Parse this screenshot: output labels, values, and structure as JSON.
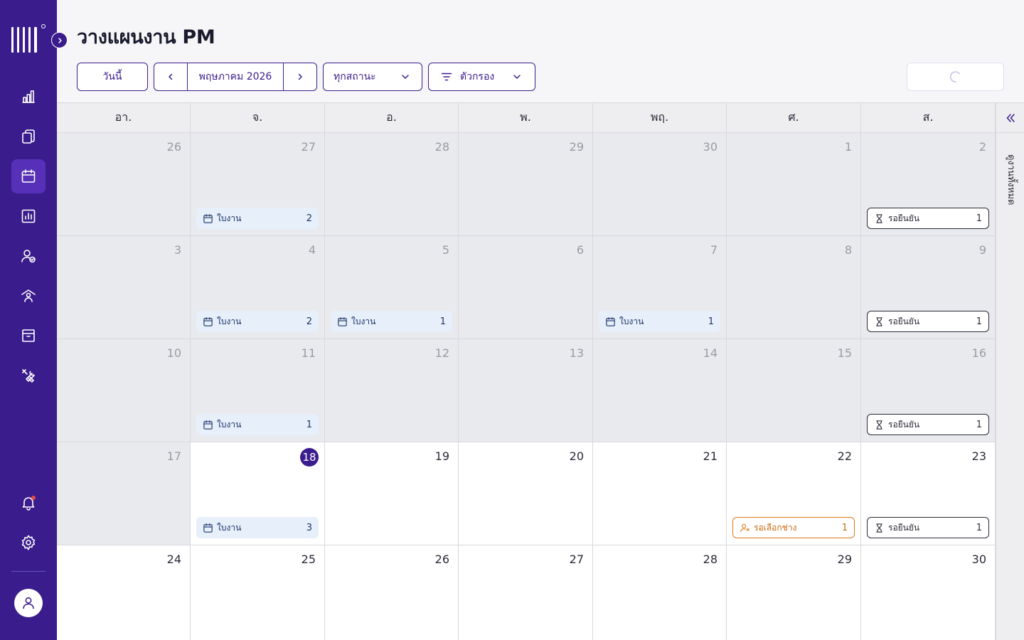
{
  "page": {
    "title": "วางแผนงาน PM"
  },
  "toolbar": {
    "today_label": "วันนี้",
    "month_label": "พฤษภาคม 2026",
    "status_label": "ทุกสถานะ",
    "filter_label": "ตัวกรอง"
  },
  "calendar": {
    "weekdays": [
      "อา.",
      "จ.",
      "อ.",
      "พ.",
      "พฤ.",
      "ศ.",
      "ส."
    ],
    "today": 18,
    "weeks": [
      [
        {
          "day": "26",
          "past": true,
          "events": []
        },
        {
          "day": "27",
          "past": true,
          "events": [
            {
              "type": "job",
              "label": "ใบงาน",
              "count": "2"
            }
          ]
        },
        {
          "day": "28",
          "past": true,
          "events": []
        },
        {
          "day": "29",
          "past": true,
          "events": []
        },
        {
          "day": "30",
          "past": true,
          "events": []
        },
        {
          "day": "1",
          "past": true,
          "events": []
        },
        {
          "day": "2",
          "past": true,
          "events": [
            {
              "type": "confirm",
              "label": "รอยืนยัน",
              "count": "1"
            }
          ]
        }
      ],
      [
        {
          "day": "3",
          "past": true,
          "events": []
        },
        {
          "day": "4",
          "past": true,
          "events": [
            {
              "type": "job",
              "label": "ใบงาน",
              "count": "2"
            }
          ]
        },
        {
          "day": "5",
          "past": true,
          "events": [
            {
              "type": "job",
              "label": "ใบงาน",
              "count": "1"
            }
          ]
        },
        {
          "day": "6",
          "past": true,
          "events": []
        },
        {
          "day": "7",
          "past": true,
          "events": [
            {
              "type": "job",
              "label": "ใบงาน",
              "count": "1"
            }
          ]
        },
        {
          "day": "8",
          "past": true,
          "events": []
        },
        {
          "day": "9",
          "past": true,
          "events": [
            {
              "type": "confirm",
              "label": "รอยืนยัน",
              "count": "1"
            }
          ]
        }
      ],
      [
        {
          "day": "10",
          "past": true,
          "events": []
        },
        {
          "day": "11",
          "past": true,
          "events": [
            {
              "type": "job",
              "label": "ใบงาน",
              "count": "1"
            }
          ]
        },
        {
          "day": "12",
          "past": true,
          "events": []
        },
        {
          "day": "13",
          "past": true,
          "events": []
        },
        {
          "day": "14",
          "past": true,
          "events": []
        },
        {
          "day": "15",
          "past": true,
          "events": []
        },
        {
          "day": "16",
          "past": true,
          "events": [
            {
              "type": "confirm",
              "label": "รอยืนยัน",
              "count": "1"
            }
          ]
        }
      ],
      [
        {
          "day": "17",
          "past": true,
          "events": []
        },
        {
          "day": "18",
          "past": false,
          "events": [
            {
              "type": "job",
              "label": "ใบงาน",
              "count": "3"
            }
          ]
        },
        {
          "day": "19",
          "past": false,
          "events": []
        },
        {
          "day": "20",
          "past": false,
          "events": []
        },
        {
          "day": "21",
          "past": false,
          "events": []
        },
        {
          "day": "22",
          "past": false,
          "events": [
            {
              "type": "select",
              "label": "รอเลือกช่าง",
              "count": "1"
            }
          ]
        },
        {
          "day": "23",
          "past": false,
          "events": [
            {
              "type": "confirm",
              "label": "รอยืนยัน",
              "count": "1"
            }
          ]
        }
      ],
      [
        {
          "day": "24",
          "past": false,
          "events": []
        },
        {
          "day": "25",
          "past": false,
          "events": []
        },
        {
          "day": "26",
          "past": false,
          "events": []
        },
        {
          "day": "27",
          "past": false,
          "events": []
        },
        {
          "day": "28",
          "past": false,
          "events": []
        },
        {
          "day": "29",
          "past": false,
          "events": []
        },
        {
          "day": "30",
          "past": false,
          "events": []
        }
      ]
    ]
  },
  "side_panel": {
    "label": "ดูงานทั้งหมด"
  },
  "sidebar": {
    "items": [
      {
        "icon": "bar-chart-icon",
        "name": "sidebar-item-dashboard"
      },
      {
        "icon": "documents-icon",
        "name": "sidebar-item-documents"
      },
      {
        "icon": "calendar-icon",
        "name": "sidebar-item-pm-planning",
        "active": true
      },
      {
        "icon": "report-icon",
        "name": "sidebar-item-reports"
      },
      {
        "icon": "user-check-icon",
        "name": "sidebar-item-technicians"
      },
      {
        "icon": "building-user-icon",
        "name": "sidebar-item-customers"
      },
      {
        "icon": "archive-icon",
        "name": "sidebar-item-inventory"
      },
      {
        "icon": "tools-icon",
        "name": "sidebar-item-tools"
      }
    ]
  },
  "colors": {
    "brand": "#3a1c8c",
    "job_chip": "#e6effa",
    "select_chip_border": "#d97a17",
    "past_cell": "#e9eaee"
  }
}
